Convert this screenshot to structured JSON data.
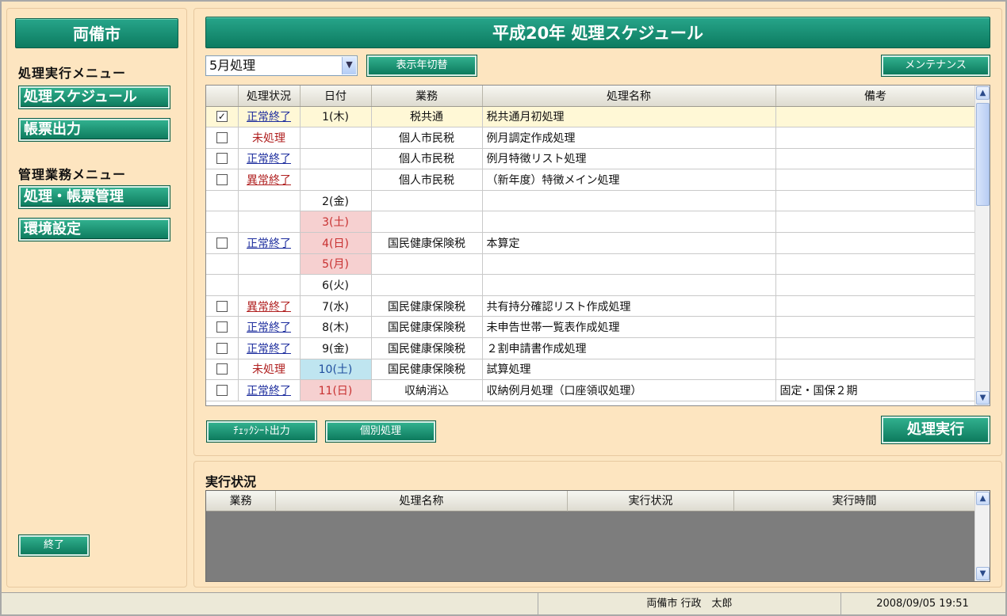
{
  "sidebar": {
    "city_title": "両備市",
    "process_menu_heading": "処理実行メニュー",
    "process_menu_items": [
      "処理スケジュール",
      "帳票出力"
    ],
    "admin_menu_heading": "管理業務メニュー",
    "admin_menu_items": [
      "処理・帳票管理",
      "環境設定"
    ],
    "exit_label": "終了"
  },
  "main": {
    "title": "平成20年 処理スケジュール",
    "month_select_value": "5月処理",
    "switch_year_label": "表示年切替",
    "maintenance_label": "メンテナンス",
    "columns": [
      "",
      "処理状況",
      "日付",
      "業務",
      "処理名称",
      "備考"
    ],
    "rows": [
      {
        "checked": true,
        "status": "正常終了",
        "status_type": "ok",
        "date": "1(木)",
        "date_type": "",
        "business": "税共通",
        "name": "税共通月初処理",
        "note": "",
        "selected": true
      },
      {
        "checked": false,
        "status": "未処理",
        "status_type": "none",
        "date": "",
        "date_type": "",
        "business": "個人市民税",
        "name": "例月調定作成処理",
        "note": ""
      },
      {
        "checked": false,
        "status": "正常終了",
        "status_type": "ok",
        "date": "",
        "date_type": "",
        "business": "個人市民税",
        "name": "例月特徴リスト処理",
        "note": ""
      },
      {
        "checked": false,
        "status": "異常終了",
        "status_type": "err",
        "date": "",
        "date_type": "",
        "business": "個人市民税",
        "name": "（新年度）特徴メイン処理",
        "note": ""
      },
      {
        "checkbox": false,
        "status": "",
        "status_type": "",
        "date": "2(金)",
        "date_type": "",
        "business": "",
        "name": "",
        "note": ""
      },
      {
        "checkbox": false,
        "status": "",
        "status_type": "",
        "date": "3(土)",
        "date_type": "red",
        "business": "",
        "name": "",
        "note": ""
      },
      {
        "checked": false,
        "status": "正常終了",
        "status_type": "ok",
        "date": "4(日)",
        "date_type": "red",
        "business": "国民健康保険税",
        "name": "本算定",
        "note": ""
      },
      {
        "checkbox": false,
        "status": "",
        "status_type": "",
        "date": "5(月)",
        "date_type": "red",
        "business": "",
        "name": "",
        "note": ""
      },
      {
        "checkbox": false,
        "status": "",
        "status_type": "",
        "date": "6(火)",
        "date_type": "",
        "business": "",
        "name": "",
        "note": ""
      },
      {
        "checked": false,
        "status": "異常終了",
        "status_type": "err",
        "date": "7(水)",
        "date_type": "",
        "business": "国民健康保険税",
        "name": "共有持分確認リスト作成処理",
        "note": ""
      },
      {
        "checked": false,
        "status": "正常終了",
        "status_type": "ok",
        "date": "8(木)",
        "date_type": "",
        "business": "国民健康保険税",
        "name": "未申告世帯一覧表作成処理",
        "note": ""
      },
      {
        "checked": false,
        "status": "正常終了",
        "status_type": "ok",
        "date": "9(金)",
        "date_type": "",
        "business": "国民健康保険税",
        "name": "２割申請書作成処理",
        "note": ""
      },
      {
        "checked": false,
        "status": "未処理",
        "status_type": "none",
        "date": "10(土)",
        "date_type": "blue",
        "business": "国民健康保険税",
        "name": "試算処理",
        "note": ""
      },
      {
        "checked": false,
        "status": "正常終了",
        "status_type": "ok",
        "date": "11(日)",
        "date_type": "red",
        "business": "収納消込",
        "name": "収納例月処理（口座領収処理）",
        "note": "固定・国保２期"
      }
    ],
    "checksheet_label": "ﾁｪｯｸｼｰﾄ出力",
    "individual_label": "個別処理",
    "execute_label": "処理実行"
  },
  "exec_status": {
    "title": "実行状況",
    "columns": [
      "業務",
      "処理名称",
      "実行状況",
      "実行時間"
    ]
  },
  "statusbar": {
    "user": "両備市 行政　太郎",
    "datetime": "2008/09/05 19:51"
  }
}
